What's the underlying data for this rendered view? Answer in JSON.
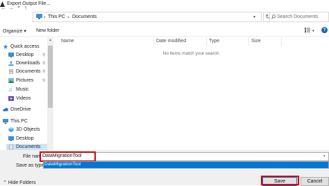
{
  "window": {
    "title": "Export Output File..."
  },
  "address": {
    "crumbs": [
      "This PC",
      "Documents"
    ]
  },
  "search": {
    "placeholder": "Search Documents"
  },
  "toolbar": {
    "organize": "Organize ▾",
    "new_folder": "New folder"
  },
  "nav": {
    "items": [
      {
        "label": "Quick access",
        "icon": "star-icon",
        "pinned": false
      },
      {
        "label": "Desktop",
        "icon": "desktop-folder-icon",
        "pinned": true
      },
      {
        "label": "Downloads",
        "icon": "download-folder-icon",
        "pinned": true
      },
      {
        "label": "Documents",
        "icon": "documents-folder-icon",
        "pinned": true
      },
      {
        "label": "Pictures",
        "icon": "pictures-folder-icon",
        "pinned": true
      },
      {
        "label": "Music",
        "icon": "music-icon",
        "pinned": false
      },
      {
        "label": "Videos",
        "icon": "videos-folder-icon",
        "pinned": false
      },
      {
        "label": "OneDrive",
        "icon": "cloud-icon",
        "pinned": false
      },
      {
        "label": "This PC",
        "icon": "computer-icon",
        "pinned": false
      },
      {
        "label": "3D Objects",
        "icon": "3d-objects-icon",
        "pinned": false
      },
      {
        "label": "Desktop",
        "icon": "desktop-folder-icon",
        "pinned": false
      },
      {
        "label": "Documents",
        "icon": "documents-folder-icon",
        "pinned": false
      }
    ]
  },
  "columns": {
    "name": "Name",
    "date": "Date modified",
    "type": "Type",
    "size": "Size"
  },
  "content": {
    "empty_message": "No items match your search."
  },
  "form": {
    "filename_label": "File name:",
    "filename_value": "DataMigrationTool",
    "savetype_label": "Save as type:",
    "autocomplete_value": "DataMigrationTool"
  },
  "buttons": {
    "save": "Save",
    "cancel": "Cancel",
    "hide_folders": "Hide Folders"
  },
  "colors": {
    "accent": "#0078d7",
    "highlight": "#d40000",
    "folder": "#f5c842"
  }
}
